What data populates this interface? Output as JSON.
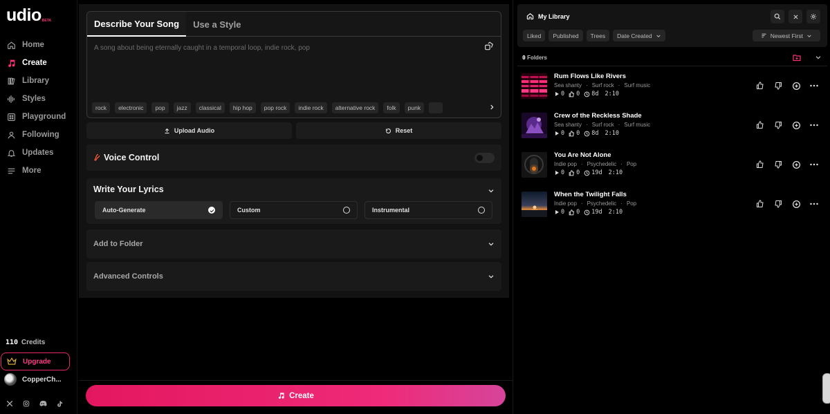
{
  "brand": {
    "name": "udio",
    "badge": "BETA",
    "accent": "#ff2e79"
  },
  "nav": [
    {
      "label": "Home",
      "icon": "home-icon"
    },
    {
      "label": "Create",
      "icon": "music-note-icon"
    },
    {
      "label": "Library",
      "icon": "library-icon"
    },
    {
      "label": "Styles",
      "icon": "waveform-icon"
    },
    {
      "label": "Playground",
      "icon": "playground-icon"
    },
    {
      "label": "Following",
      "icon": "person-icon"
    },
    {
      "label": "Updates",
      "icon": "bell-icon"
    },
    {
      "label": "More",
      "icon": "menu-icon"
    }
  ],
  "account": {
    "credits_value": "110",
    "credits_label": "Credits",
    "upgrade_label": "Upgrade",
    "username": "CopperCh..."
  },
  "socials": [
    "x-icon",
    "instagram-icon",
    "discord-icon",
    "tiktok-icon"
  ],
  "create": {
    "tabs": [
      "Describe Your Song",
      "Use a Style"
    ],
    "prompt_placeholder": "A song about being eternally caught in a temporal loop, indie rock, pop",
    "chips": [
      "rock",
      "electronic",
      "pop",
      "jazz",
      "classical",
      "hip hop",
      "pop rock",
      "indie rock",
      "alternative rock",
      "folk",
      "punk"
    ],
    "upload_label": "Upload Audio",
    "reset_label": "Reset",
    "voice_control_label": "Voice Control",
    "voice_control_on": false,
    "lyrics_title": "Write Your Lyrics",
    "lyric_options": [
      "Auto-Generate",
      "Custom",
      "Instrumental"
    ],
    "lyric_selected": "Auto-Generate",
    "add_folder_label": "Add to Folder",
    "advanced_label": "Advanced Controls",
    "create_button": "Create"
  },
  "library": {
    "title": "My Library",
    "filters": [
      "Liked",
      "Published",
      "Trees",
      "Date Created"
    ],
    "sort_label": "Newest First",
    "folders_count": "0",
    "folders_label": "Folders",
    "tracks": [
      {
        "title": "Rum Flows Like Rivers",
        "tags": [
          "Sea shanty",
          "Surf rock",
          "Surf music"
        ],
        "plays": "0",
        "likes": "0",
        "age": "8d",
        "duration": "2:10"
      },
      {
        "title": "Crew of the Reckless Shade",
        "tags": [
          "Sea shanty",
          "Surf rock",
          "Surf music"
        ],
        "plays": "0",
        "likes": "0",
        "age": "8d",
        "duration": "2:10"
      },
      {
        "title": "You Are Not Alone",
        "tags": [
          "Indie pop",
          "Psychedelic",
          "Pop"
        ],
        "plays": "0",
        "likes": "0",
        "age": "19d",
        "duration": "2:10"
      },
      {
        "title": "When the Twilight Falls",
        "tags": [
          "Indie pop",
          "Psychedelic",
          "Pop"
        ],
        "plays": "0",
        "likes": "0",
        "age": "19d",
        "duration": "2:10"
      }
    ]
  }
}
